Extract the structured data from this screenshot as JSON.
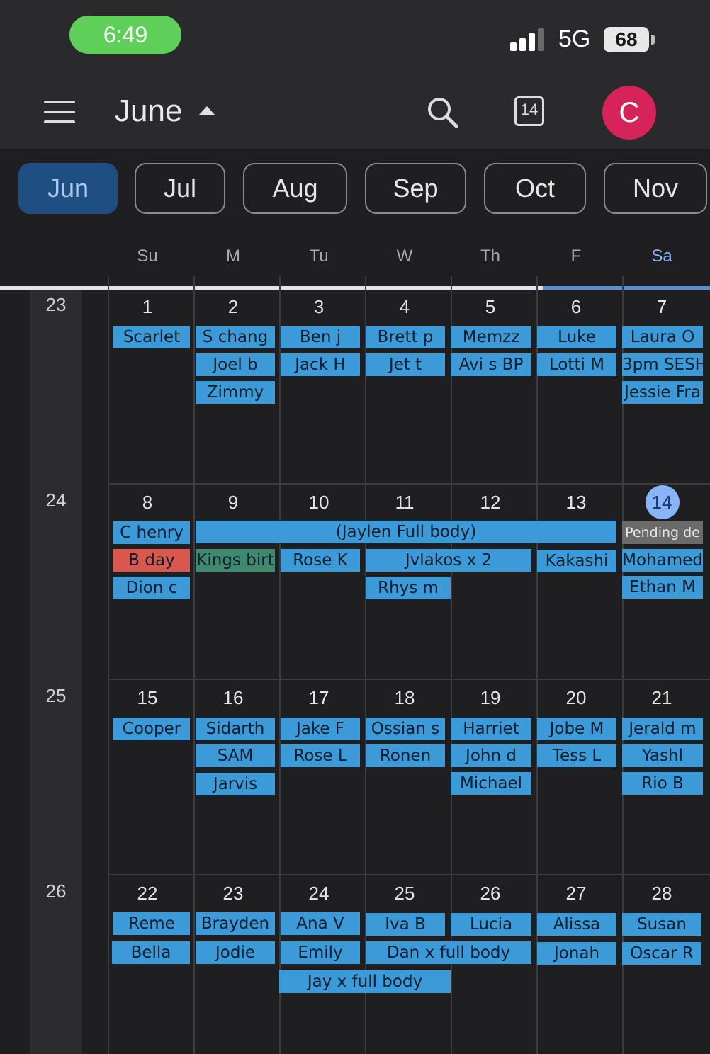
{
  "status_bar": {
    "time": "6:49",
    "network": "5G",
    "battery": "68"
  },
  "header": {
    "month_title": "June",
    "today_number": "14",
    "avatar_letter": "C"
  },
  "month_chips": [
    "Jun",
    "Jul",
    "Aug",
    "Sep",
    "Oct",
    "Nov"
  ],
  "weekdays": [
    "Su",
    "M",
    "Tu",
    "W",
    "Th",
    "F",
    "Sa"
  ],
  "weeks": [
    {
      "week_number": "23",
      "days": [
        "1",
        "2",
        "3",
        "4",
        "5",
        "6",
        "7"
      ],
      "events": [
        [
          "Scarlet"
        ],
        [
          "S chang",
          "Joel b",
          "Zimmy"
        ],
        [
          "Ben j",
          "Jack H"
        ],
        [
          "Brett p",
          "Jet t"
        ],
        [
          "Memzz",
          "Avi s BP"
        ],
        [
          "Luke",
          "Lotti M"
        ],
        [
          "Laura O",
          "3pm SESH",
          "Jessie Fra"
        ]
      ]
    },
    {
      "week_number": "24",
      "days": [
        "8",
        "9",
        "10",
        "11",
        "12",
        "13",
        "14"
      ],
      "spanning_event": "(Jaylen Full body)",
      "events": {
        "sun": [
          "C henry",
          "B day",
          "Dion c"
        ],
        "mon": "Kings birt",
        "tue": "Rose K",
        "wed_thu": "Jvlakos x 2",
        "wed": "Rhys m",
        "fri": "Kakashi",
        "sat": [
          "Pending de",
          "Mohamed",
          "Ethan M"
        ]
      }
    },
    {
      "week_number": "25",
      "days": [
        "15",
        "16",
        "17",
        "18",
        "19",
        "20",
        "21"
      ],
      "events": [
        [
          "Cooper"
        ],
        [
          "Sidarth",
          "SAM",
          "Jarvis"
        ],
        [
          "Jake F",
          "Rose L"
        ],
        [
          "Ossian s",
          "Ronen"
        ],
        [
          "Harriet",
          "John d",
          "Michael"
        ],
        [
          "Jobe M",
          "Tess L"
        ],
        [
          "Jerald m",
          "Yashl",
          "Rio B"
        ]
      ]
    },
    {
      "week_number": "26",
      "days": [
        "22",
        "23",
        "24",
        "25",
        "26",
        "27",
        "28"
      ],
      "events": {
        "sun": [
          "Reme",
          "Bella"
        ],
        "mon": [
          "Brayden",
          "Jodie"
        ],
        "tue": [
          "Ana V",
          "Emily"
        ],
        "wed": "Iva B",
        "thu": "Lucia",
        "wed_thu": "Dan x full body",
        "tue_wed": "Jay x full body",
        "fri": [
          "Alissa",
          "Jonah"
        ],
        "sat": [
          "Susan",
          "Oscar R"
        ]
      }
    }
  ],
  "colors": {
    "event_blue": "#3d9ad8",
    "event_red": "#d9574c",
    "event_green": "#3f8a6e",
    "today": "#8ab4f8",
    "avatar": "#d6245a"
  }
}
